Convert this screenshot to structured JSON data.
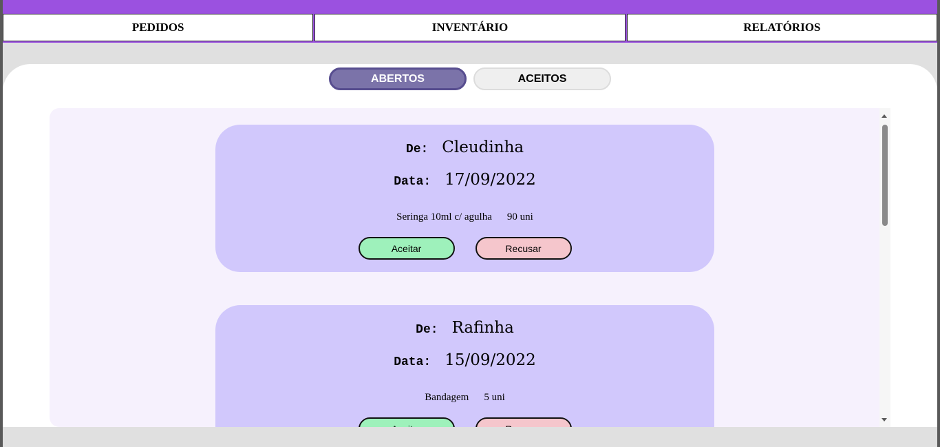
{
  "nav": {
    "items": [
      {
        "label": "PEDIDOS"
      },
      {
        "label": "INVENTÁRIO"
      },
      {
        "label": "RELATÓRIOS"
      }
    ]
  },
  "tabs": [
    {
      "label": "ABERTOS",
      "active": true
    },
    {
      "label": "ACEITOS",
      "active": false
    }
  ],
  "orders": [
    {
      "from_label": "De:",
      "from": "Cleudinha",
      "date_label": "Data:",
      "date": "17/09/2022",
      "item": "Seringa 10ml c/ agulha",
      "qty": "90 uni",
      "accept_label": "Aceitar",
      "reject_label": "Recusar"
    },
    {
      "from_label": "De:",
      "from": "Rafinha",
      "date_label": "Data:",
      "date": "15/09/2022",
      "item": "Bandagem",
      "qty": "5 uni",
      "accept_label": "Aceitar",
      "reject_label": "Recusar"
    }
  ],
  "colors": {
    "accent": "#9b51e0",
    "tab_active": "#7b73a9",
    "card": "#d1c8fc",
    "list_bg": "#f6f1fd",
    "accept": "#9ef1bb",
    "reject": "#f5c6cc"
  }
}
